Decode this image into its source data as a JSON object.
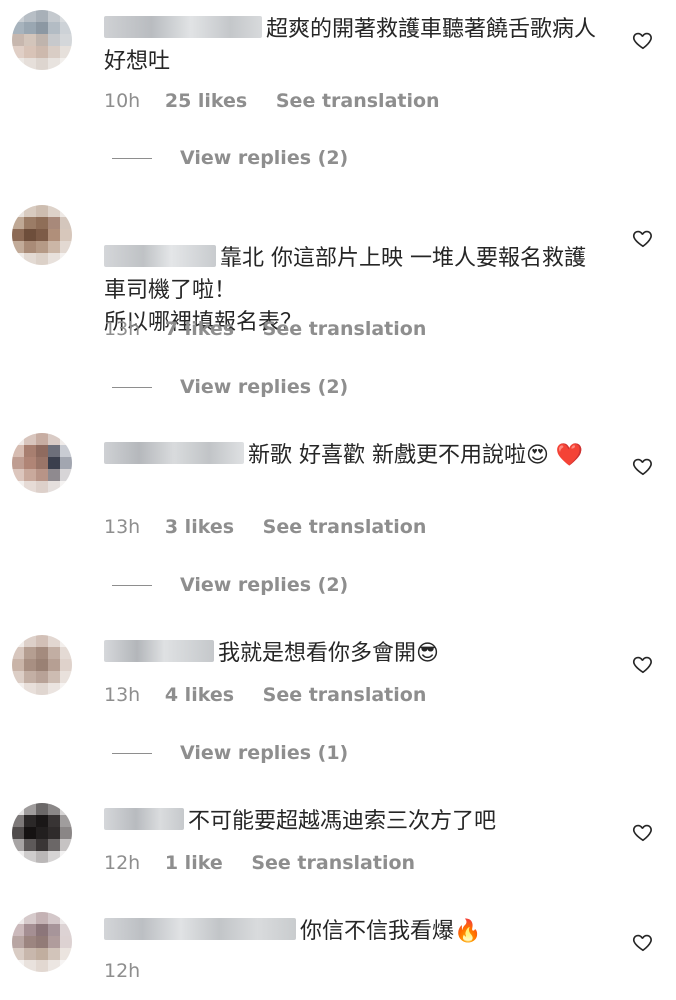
{
  "comments": [
    {
      "text": "超爽的開著救護車聽著饒舌歌病人好想吐",
      "time": "10h",
      "likes": "25 likes",
      "translate": "See translation",
      "replies": "View replies (2)"
    },
    {
      "text": "靠北 你這部片上映 一堆人要報名救護車司機了啦！\n所以哪裡填報名表？",
      "time": "13h",
      "likes": "7 likes",
      "translate": "See translation",
      "replies": "View replies (2)"
    },
    {
      "text": "新歌 好喜歡 新戲更不用說啦",
      "emoji": "😍 ❤️",
      "time": "13h",
      "likes": "3 likes",
      "translate": "See translation",
      "replies": "View replies (2)"
    },
    {
      "text": "我就是想看你多會開",
      "emoji": "😎",
      "time": "13h",
      "likes": "4 likes",
      "translate": "See translation",
      "replies": "View replies (1)"
    },
    {
      "text": "不可能要超越馮迪索三次方了吧",
      "time": "12h",
      "likes": "1 like",
      "translate": "See translation"
    },
    {
      "text": "你信不信我看爆",
      "emoji": "🔥",
      "time": "12h"
    }
  ],
  "icons": {
    "like": "heart-icon"
  },
  "colors": {
    "text": "#262626",
    "secondary": "#8e8e8e",
    "background": "#ffffff"
  }
}
